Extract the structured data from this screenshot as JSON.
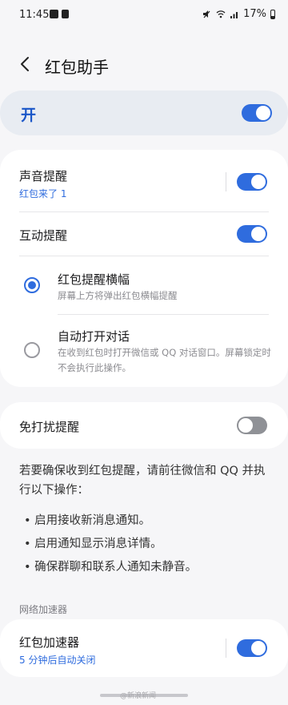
{
  "status_bar": {
    "time": "11:45",
    "battery": "17%",
    "icons": [
      "gallery-icon",
      "nfc-icon",
      "mute-icon",
      "wifi-icon",
      "signal-icon",
      "battery-icon"
    ]
  },
  "header": {
    "title": "红包助手",
    "back_icon": "chevron-left-icon"
  },
  "master": {
    "label": "开",
    "enabled": true
  },
  "settings_card": {
    "sound": {
      "title": "声音提醒",
      "subtitle": "红包来了 1",
      "enabled": true
    },
    "interactive": {
      "title": "互动提醒",
      "enabled": true
    },
    "banner": {
      "title": "红包提醒横幅",
      "desc": "屏幕上方将弹出红包横幅提醒",
      "selected": true
    },
    "auto_open": {
      "title": "自动打开对话",
      "desc": "在收到红包时打开微信或 QQ 对话窗口。屏幕锁定时不会执行此操作。",
      "selected": false
    }
  },
  "dnd": {
    "title": "免打扰提醒",
    "enabled": false
  },
  "info": {
    "intro": "若要确保收到红包提醒，请前往微信和 QQ 并执行以下操作：",
    "bullets": [
      "• 启用接收新消息通知。",
      "• 启用通知显示消息详情。",
      "• 确保群聊和联系人通知未静音。"
    ]
  },
  "network_section": {
    "header": "网络加速器",
    "accelerator": {
      "title": "红包加速器",
      "subtitle": "5 分钟后自动关闭",
      "enabled": true
    }
  },
  "colors": {
    "accent": "#2f6cde",
    "background": "#f6f6f8",
    "card": "#ffffff",
    "master_bg": "#e8ecf2"
  },
  "watermark": "@新浪新闻"
}
